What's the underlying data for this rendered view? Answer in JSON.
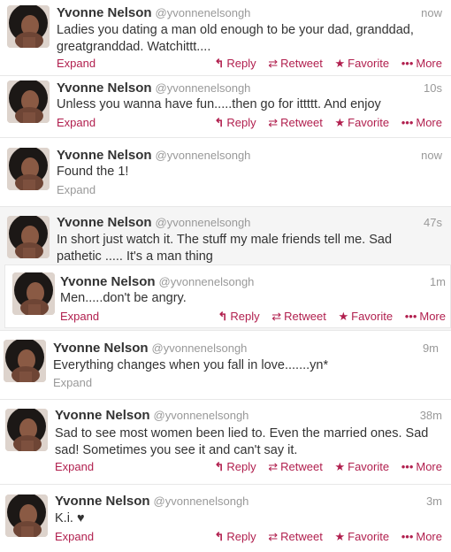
{
  "user": {
    "name": "Yvonne Nelson",
    "handle": "@yvonnenelsongh"
  },
  "labels": {
    "expand": "Expand",
    "reply": "Reply",
    "retweet": "Retweet",
    "favorite": "Favorite",
    "more": "More"
  },
  "tweets": [
    {
      "time": "now",
      "text": "Ladies you dating a man old enough to be your dad, granddad, greatgranddad. Watchittt...."
    },
    {
      "time": "10s",
      "text": "Unless you wanna have fun.....then go for ittttt. And enjoy"
    },
    {
      "time": "now",
      "text": "Found the 1!"
    },
    {
      "time": "47s",
      "text": "In short just watch it. The stuff my male friends tell me. Sad pathetic ..... It's a man thing"
    },
    {
      "time": "1m",
      "text": "Men.....don't be angry."
    },
    {
      "time": "9m",
      "text": "Everything changes when you fall in love.......yn*"
    },
    {
      "time": "38m",
      "text": "Sad to see most women been lied to. Even the married ones. Sad sad! Sometimes you see it and can't say it."
    },
    {
      "time": "3m",
      "text": "K.i. ♥"
    }
  ],
  "colors": {
    "accent": "#b11f4e",
    "muted": "#999999",
    "text": "#333333"
  },
  "icons": {
    "reply": "reply-arrow-icon",
    "retweet": "retweet-icon",
    "favorite": "star-icon",
    "more": "ellipsis-icon"
  }
}
